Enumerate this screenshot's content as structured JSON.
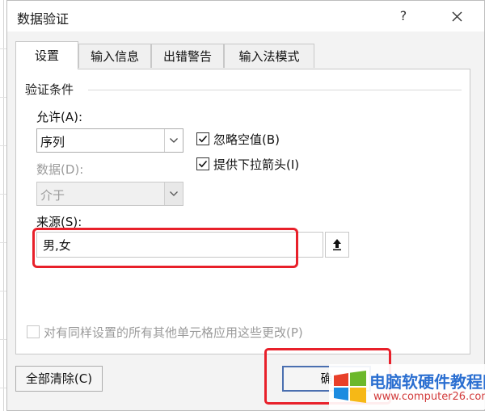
{
  "dialog": {
    "title": "数据验证",
    "help": "?"
  },
  "tabs": [
    {
      "label": "设置",
      "active": true
    },
    {
      "label": "输入信息",
      "active": false
    },
    {
      "label": "出错警告",
      "active": false
    },
    {
      "label": "输入法模式",
      "active": false
    }
  ],
  "criteria": {
    "group_label": "验证条件",
    "allow_label": "允许(A):",
    "allow_value": "序列",
    "data_label": "数据(D):",
    "data_value": "介于",
    "ignore_blank_label": "忽略空值(B)",
    "ignore_blank_checked": true,
    "dropdown_label": "提供下拉箭头(I)",
    "dropdown_checked": true,
    "source_label": "来源(S):",
    "source_value": "男,女",
    "apply_all_label": "对有同样设置的所有其他单元格应用这些更改(P)",
    "apply_all_checked": false
  },
  "buttons": {
    "clear_all": "全部清除(C)",
    "ok_fragment": "确"
  },
  "watermark": {
    "title": "电脑软硬件教程网",
    "url": "www.computer26.com"
  },
  "colors": {
    "highlight": "#e8202a",
    "default_button_border": "#4a6fb0",
    "watermark_blue": "#2b6fd1",
    "watermark_red": "#d23b3b"
  }
}
